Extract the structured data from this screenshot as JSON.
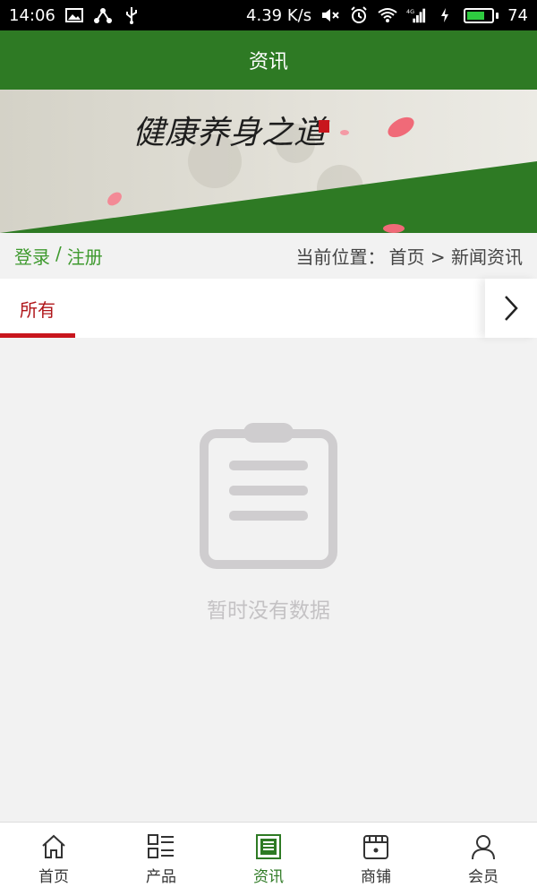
{
  "status_bar": {
    "time": "14:06",
    "speed": "4.39 K/s",
    "network": "4G",
    "battery": "74",
    "battery_level": 0.74
  },
  "header": {
    "title": "资讯"
  },
  "banner": {
    "calligraphy": "健康养身之道"
  },
  "crumbs": {
    "login": "登录",
    "separator": "/",
    "register": "注册",
    "location_label": "当前位置：",
    "location_path": "首页 > 新闻资讯"
  },
  "tabs": [
    {
      "label": "所有",
      "active": true
    }
  ],
  "empty": {
    "message": "暂时没有数据"
  },
  "bottom_nav": {
    "items": [
      {
        "label": "首页",
        "icon": "home-icon"
      },
      {
        "label": "产品",
        "icon": "product-grid-icon"
      },
      {
        "label": "资讯",
        "icon": "news-icon",
        "active": true
      },
      {
        "label": "商铺",
        "icon": "store-icon"
      },
      {
        "label": "会员",
        "icon": "user-icon"
      }
    ]
  },
  "colors": {
    "primary": "#2e7a24",
    "accent_red": "#c8161d",
    "link_green": "#3f9a2f"
  }
}
